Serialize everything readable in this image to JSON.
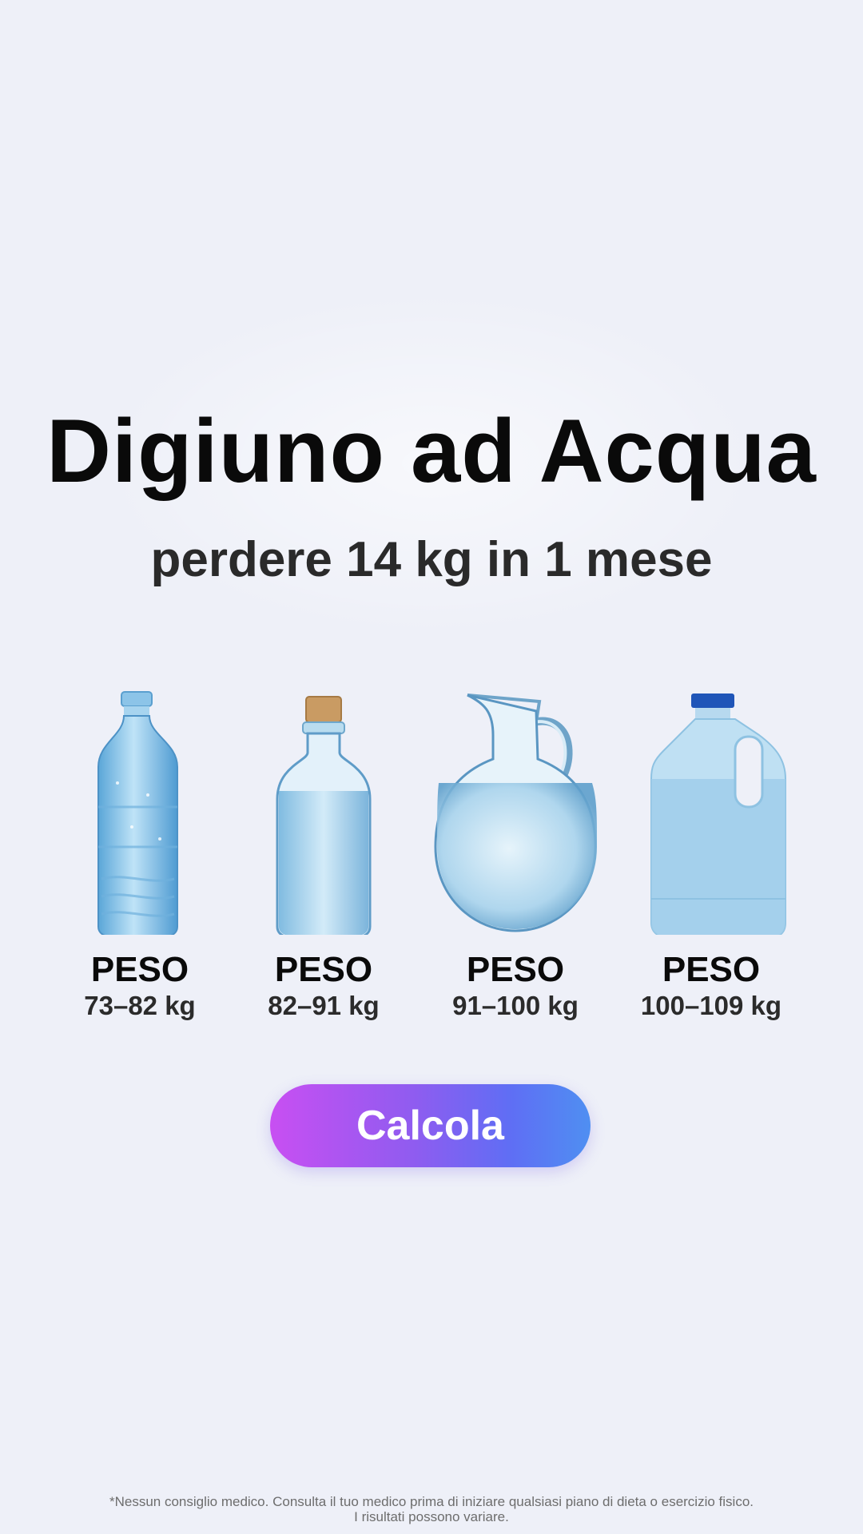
{
  "hero": {
    "title": "Digiuno ad Acqua",
    "subtitle": "perdere 14 kg in 1 mese"
  },
  "options": [
    {
      "icon": "water-bottle-icon",
      "label": "PESO",
      "range": "73–82 kg"
    },
    {
      "icon": "cork-bottle-icon",
      "label": "PESO",
      "range": "82–91 kg"
    },
    {
      "icon": "pitcher-icon",
      "label": "PESO",
      "range": "91–100 kg"
    },
    {
      "icon": "water-jug-icon",
      "label": "PESO",
      "range": "100–109 kg"
    }
  ],
  "cta": {
    "label": "Calcola"
  },
  "disclaimer": {
    "line1": "*Nessun consiglio medico. Consulta il tuo medico prima di iniziare qualsiasi piano di dieta o esercizio fisico.",
    "line2": "I risultati possono variare."
  },
  "colors": {
    "background": "#eef0f8",
    "button_start": "#c84ff2",
    "button_end": "#4f8ff2",
    "water": "#9cccea"
  }
}
